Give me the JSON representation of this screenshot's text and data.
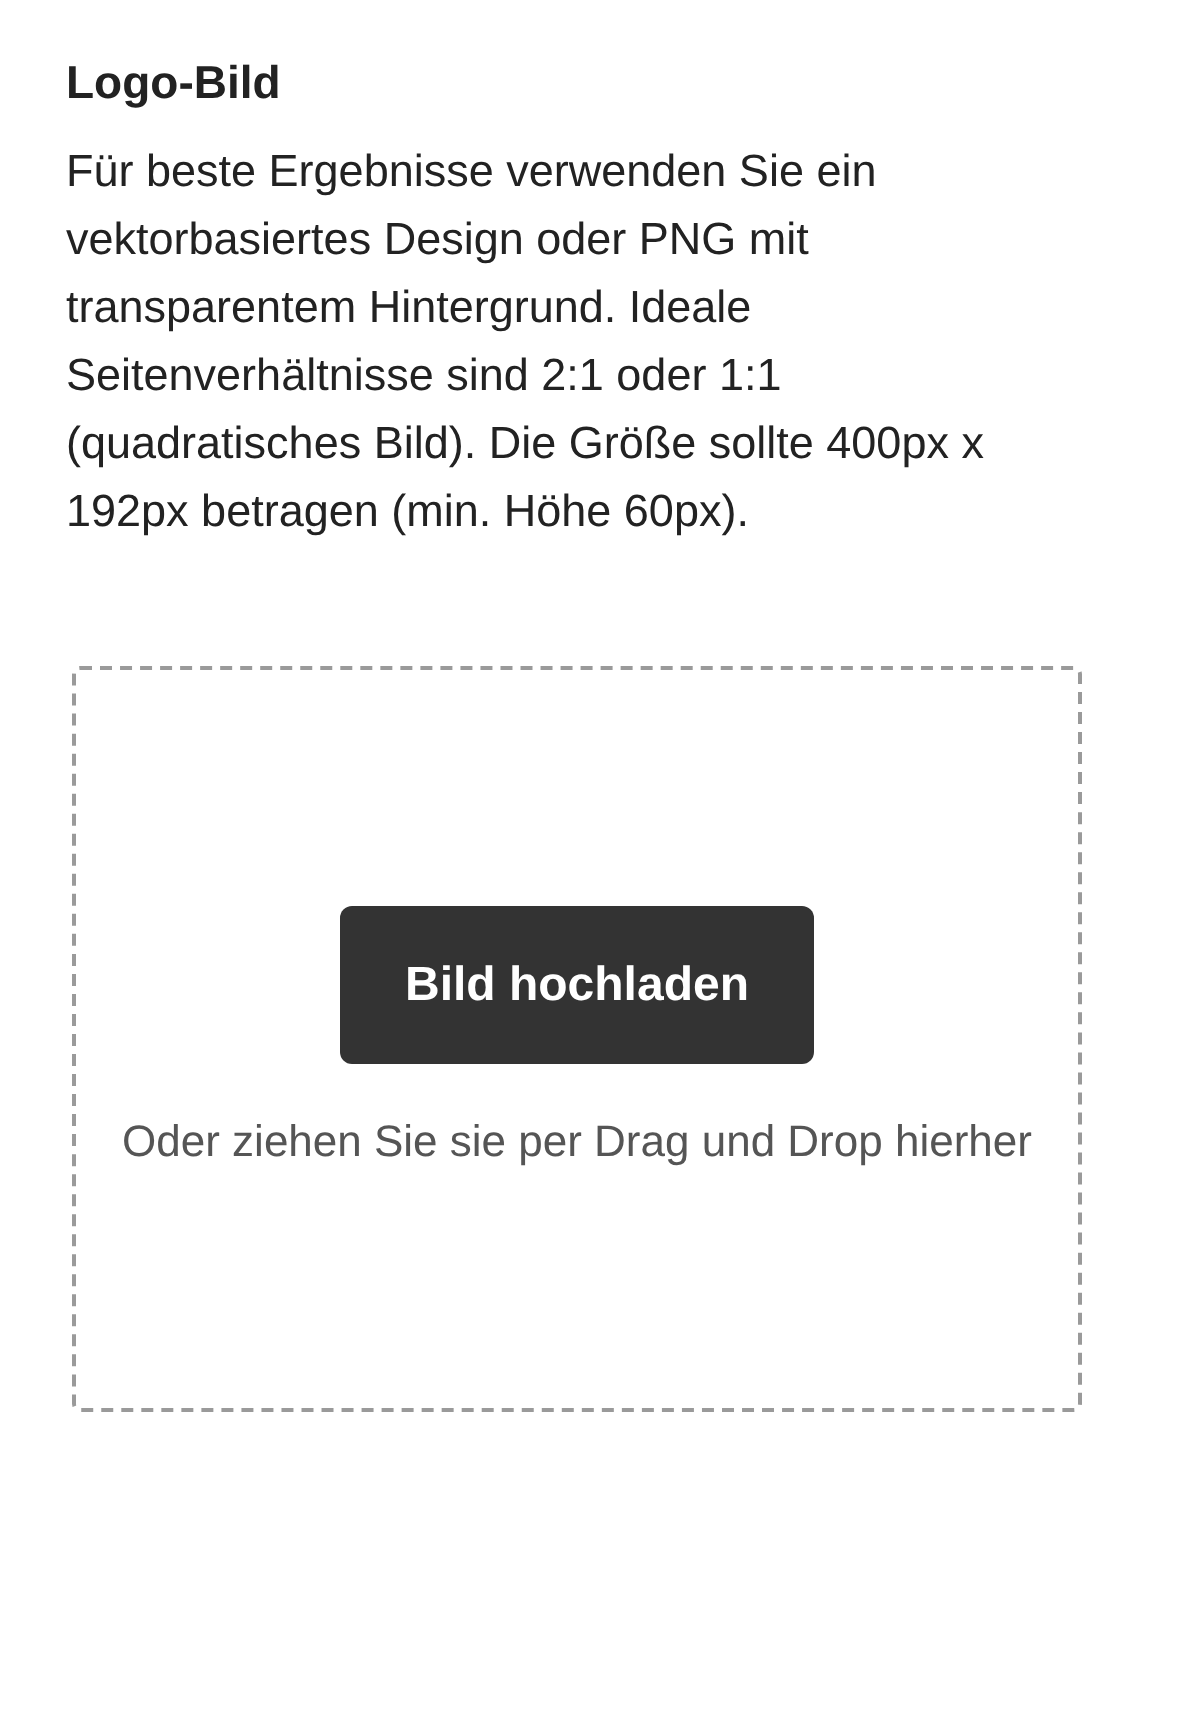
{
  "section": {
    "title": "Logo-Bild",
    "description": "Für beste Ergebnisse verwenden Sie ein vektorbasiertes Design oder PNG mit transparentem Hintergrund. Ideale Seitenverhältnisse sind 2:1 oder 1:1 (quadratisches Bild). Die Größe sollte 400px x 192px betragen (min. Höhe 60px)."
  },
  "dropzone": {
    "button": "Bild hochladen",
    "hint": "Oder ziehen Sie sie per Drag und Drop hierher"
  }
}
